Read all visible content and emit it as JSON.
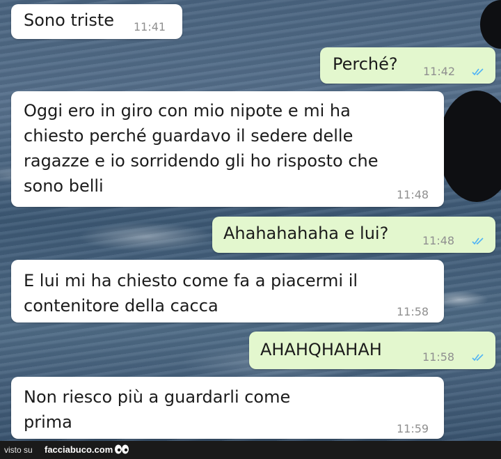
{
  "messages": [
    {
      "direction": "in",
      "text": "Sono triste",
      "time": "11:41"
    },
    {
      "direction": "out",
      "text": "Perché?",
      "time": "11:42",
      "read": true
    },
    {
      "direction": "in",
      "text": "Oggi ero in giro con mio nipote e mi ha\nchiesto perché guardavo il sedere delle\nragazze e io sorridendo gli ho risposto che\nsono belli",
      "time": "11:48"
    },
    {
      "direction": "out",
      "text": "Ahahahahaha e lui?",
      "time": "11:48",
      "read": true
    },
    {
      "direction": "in",
      "text": "E lui mi ha chiesto come fa a piacermi il\ncontenitore della cacca",
      "time": "11:58"
    },
    {
      "direction": "out",
      "text": "AHAHQHAHAH",
      "time": "11:58",
      "read": true
    },
    {
      "direction": "in",
      "text": "Non riesco più a guardarli come\nprima",
      "time": "11:59"
    }
  ],
  "footer": {
    "visto_label": "visto su",
    "site_label": "facciabuco.com",
    "logo_icon": "eyes-icon"
  },
  "colors": {
    "incoming_bubble": "#ffffff",
    "outgoing_bubble": "#e3f7ce",
    "read_ticks": "#4fb3f6",
    "footer_bg": "#1a1a1a"
  }
}
